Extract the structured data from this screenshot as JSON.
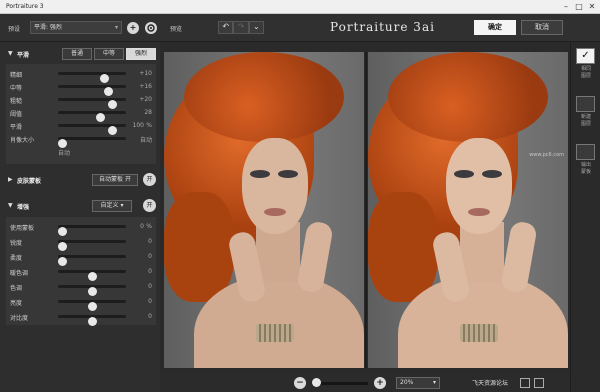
{
  "window": {
    "title": "Portraiture 3",
    "minimize": "–",
    "maximize": "□",
    "close": "✕"
  },
  "toolbar": {
    "preset_label": "预设",
    "preset_value": "平滑: 强烈",
    "add_icon": "+",
    "settings_icon": "gear-icon",
    "preview_label": "预览",
    "undo": "↶",
    "redo": "↷",
    "history": "⌄",
    "logo": "Portraiture 3ai",
    "ok": "确定",
    "cancel": "取消"
  },
  "smoothing": {
    "title": "平滑",
    "presets": [
      "普通",
      "中等",
      "强烈"
    ],
    "active_preset": "强烈",
    "sliders": [
      {
        "label": "精细",
        "value": "+10",
        "level": 0.72
      },
      {
        "label": "中等",
        "value": "+16",
        "level": 0.78
      },
      {
        "label": "粗糙",
        "value": "+20",
        "level": 0.84
      },
      {
        "label": "阈值",
        "value": "28",
        "level": 0.65
      },
      {
        "label": "平滑",
        "value": "100",
        "unit": "%",
        "level": 0.84
      },
      {
        "label": "肖像大小",
        "value": "自动",
        "level": 0.0
      }
    ],
    "auto_label": "自动"
  },
  "skin_mask": {
    "title": "皮肤蒙板",
    "auto_mask": "自动蒙板 开",
    "toggle": "开"
  },
  "enhance": {
    "title": "增强",
    "mode": "自定义",
    "toggle": "开",
    "sliders": [
      {
        "label": "使用蒙板",
        "value": "0",
        "unit": "%",
        "level": 0.0
      },
      {
        "label": "锐度",
        "value": "0",
        "level": 0.0
      },
      {
        "label": "柔度",
        "value": "0",
        "level": 0.0
      },
      {
        "label": "暖色调",
        "value": "0",
        "level": 0.5
      },
      {
        "label": "色调",
        "value": "0",
        "level": 0.5
      },
      {
        "label": "亮度",
        "value": "0",
        "level": 0.5
      },
      {
        "label": "对比度",
        "value": "0",
        "level": 0.5
      }
    ]
  },
  "rail": {
    "items": [
      {
        "label": "相同\n图层",
        "checked": true,
        "check": "✓"
      },
      {
        "label": "新建\n图层",
        "checked": false
      },
      {
        "label": "输出\n蒙板",
        "checked": false
      }
    ]
  },
  "zoom": {
    "minus": "−",
    "plus": "+",
    "value": "20%",
    "level": 0.0,
    "caret": "▾"
  },
  "watermarks": {
    "photo": "www.pc6.com",
    "site": "飞天资源论坛"
  },
  "colors": {
    "accent": "#f2f2f2",
    "panel": "#2e2e2e",
    "hair": "#c8521c"
  }
}
